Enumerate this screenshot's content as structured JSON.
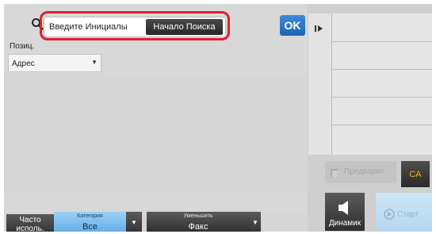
{
  "search": {
    "icon": "search-icon",
    "initials_label": "Введите Инициалы",
    "start_button": "Начало Поиска"
  },
  "ok_button": "OK",
  "position": {
    "label": "Позиц.",
    "select_value": "Адрес"
  },
  "bottom": {
    "frequent_label": "Часто исполь.",
    "category_small": "Категория",
    "category_value": "Все",
    "reduce_small": "Уменьшить",
    "reduce_value": "Факс"
  },
  "right": {
    "preview_label": "Предварит.",
    "ca_label": "CA",
    "speaker_label": "Динамик",
    "start_label": "Старт"
  },
  "colors": {
    "highlight": "#e0202f",
    "ok": "#2a74c4",
    "category": "#7bbff0",
    "ca_text": "#f4b400"
  }
}
